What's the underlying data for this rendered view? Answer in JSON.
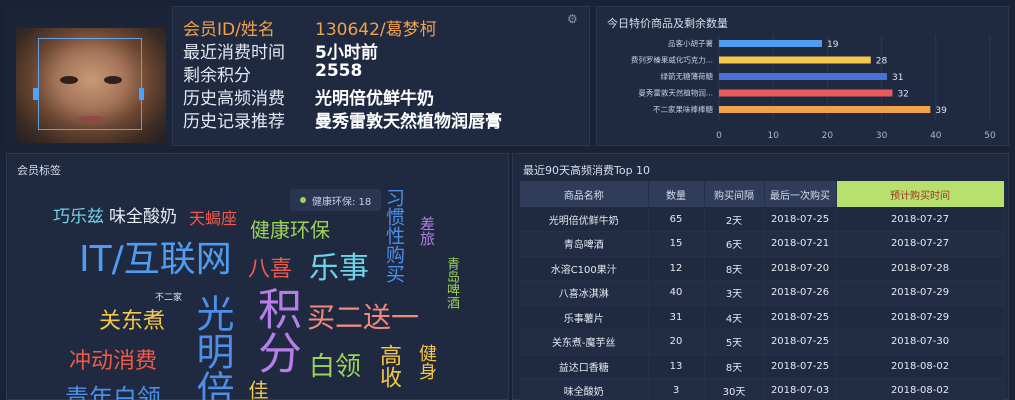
{
  "profile": {
    "rows": [
      {
        "label": "会员ID/姓名",
        "value": "130642/葛梦柯"
      },
      {
        "label": "最近消费时间",
        "value": "5小时前"
      },
      {
        "label": "剩余积分",
        "value": "2558"
      },
      {
        "label": "历史高频消费",
        "value": "光明倍优鲜牛奶"
      },
      {
        "label": "历史记录推荐",
        "value": "曼秀雷敦天然植物润唇膏"
      }
    ]
  },
  "bar_panel": {
    "title": "今日特价商品及剩余数量"
  },
  "chart_data": {
    "type": "bar",
    "orientation": "horizontal",
    "categories": [
      "品客小胡子薯",
      "费列罗榛果威化巧克力...",
      "绿箭无糖薄荷糖",
      "曼秀雷敦天然植物润...",
      "不二家果味棒棒糖"
    ],
    "values": [
      19,
      28,
      31,
      32,
      39
    ],
    "colors": [
      "#4f9cf0",
      "#f3c74b",
      "#4a6fd6",
      "#e85a5a",
      "#f0a24a"
    ],
    "xlim": [
      0,
      50
    ],
    "xticks": [
      "0",
      "10",
      "20",
      "30",
      "40",
      "50"
    ],
    "grid": true
  },
  "tags_panel": {
    "title": "会员标签",
    "legend": "健康环保: 18",
    "tags": [
      {
        "text": "巧乐兹",
        "color": "#6fd3e8",
        "size": 17
      },
      {
        "text": "味全酸奶",
        "color": "#e7ecf5",
        "size": 17
      },
      {
        "text": "天蝎座",
        "color": "#ef5a4a",
        "size": 16
      },
      {
        "text": "健康环保",
        "color": "#9bd35a",
        "size": 20
      },
      {
        "text": "习惯性购买",
        "color": "#4d8fe8",
        "size": 19
      },
      {
        "text": "差旅",
        "color": "#b67ee8",
        "size": 15
      },
      {
        "text": "青岛啤酒",
        "color": "#9bd35a",
        "size": 13
      },
      {
        "text": "IT/互联网",
        "color": "#4f9cf0",
        "size": 36
      },
      {
        "text": "八喜",
        "color": "#ef5a4a",
        "size": 22
      },
      {
        "text": "乐事",
        "color": "#6fd3e8",
        "size": 30
      },
      {
        "text": "不二家",
        "color": "#dfe5f0",
        "size": 9
      },
      {
        "text": "光明倍",
        "color": "#4d8fe8",
        "size": 38
      },
      {
        "text": "积分",
        "color": "#b67ee8",
        "size": 44
      },
      {
        "text": "买二送一",
        "color": "#f08a7a",
        "size": 28
      },
      {
        "text": "关东煮",
        "color": "#f3c74b",
        "size": 22
      },
      {
        "text": "冲动消费",
        "color": "#ef5a4a",
        "size": 22
      },
      {
        "text": "白领",
        "color": "#9bd35a",
        "size": 26
      },
      {
        "text": "高收",
        "color": "#f3c74b",
        "size": 22
      },
      {
        "text": "健身",
        "color": "#f3c74b",
        "size": 18
      },
      {
        "text": "佳",
        "color": "#f3c74b",
        "size": 20
      },
      {
        "text": "青年白领",
        "color": "#4d8fe8",
        "size": 24
      }
    ]
  },
  "table_panel": {
    "title": "最近90天高频消费Top 10",
    "headers": [
      "商品名称",
      "数量",
      "购买间隔",
      "最后一次购买",
      "预计购买时间"
    ],
    "rows": [
      [
        "光明倍优鲜牛奶",
        "65",
        "2天",
        "2018-07-25",
        "2018-07-27"
      ],
      [
        "青岛啤酒",
        "15",
        "6天",
        "2018-07-21",
        "2018-07-27"
      ],
      [
        "水溶C100果汁",
        "12",
        "8天",
        "2018-07-20",
        "2018-07-28"
      ],
      [
        "八喜冰淇淋",
        "40",
        "3天",
        "2018-07-26",
        "2018-07-29"
      ],
      [
        "乐事薯片",
        "31",
        "4天",
        "2018-07-25",
        "2018-07-29"
      ],
      [
        "关东煮-魔芋丝",
        "20",
        "5天",
        "2018-07-25",
        "2018-07-30"
      ],
      [
        "益达口香糖",
        "13",
        "8天",
        "2018-07-25",
        "2018-08-02"
      ],
      [
        "味全酸奶",
        "3",
        "30天",
        "2018-07-03",
        "2018-08-02"
      ]
    ]
  }
}
